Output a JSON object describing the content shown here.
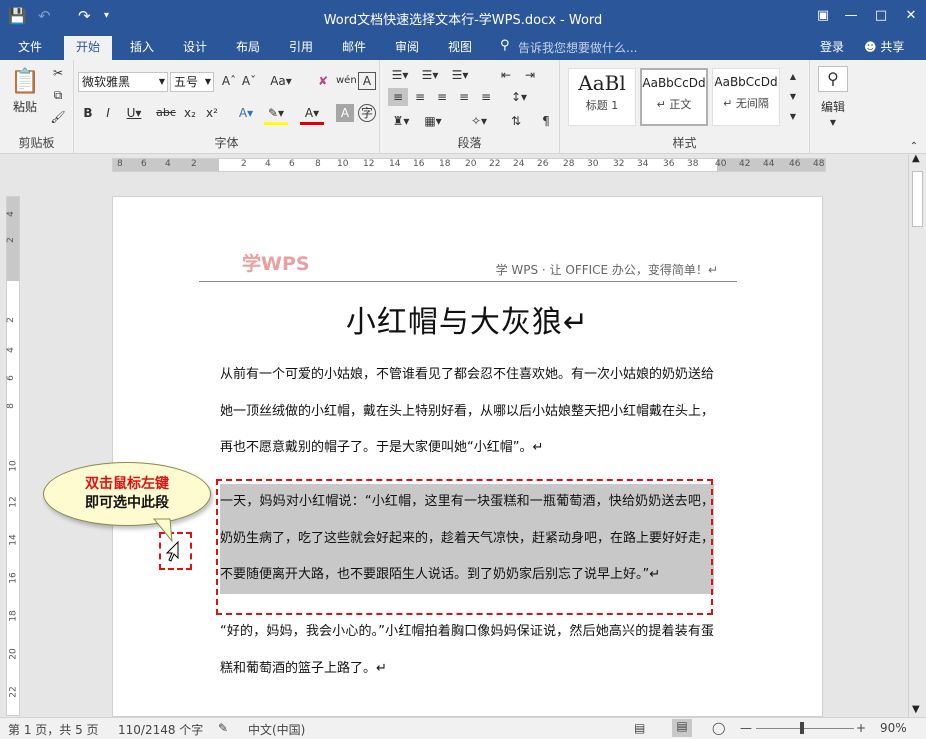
{
  "titlebar": {
    "title": "Word文档快速选择文本行-学WPS.docx - Word",
    "save_icon": "save-icon",
    "undo_icon": "undo-icon",
    "redo_icon": "redo-icon",
    "ribbon_display": "ribbon-display-icon",
    "minimize": "minimize-icon",
    "maximize": "maximize-icon",
    "close": "close-icon"
  },
  "tabs": [
    "文件",
    "开始",
    "插入",
    "设计",
    "布局",
    "引用",
    "邮件",
    "审阅",
    "视图"
  ],
  "active_tab": "开始",
  "tellme": "告诉我您想要做什么...",
  "login": "登录",
  "share": "共享",
  "ribbon": {
    "clipboard": {
      "paste": "粘贴",
      "label": "剪贴板"
    },
    "font": {
      "name": "微软雅黑",
      "size": "五号",
      "label": "字体"
    },
    "paragraph": {
      "label": "段落"
    },
    "styles": {
      "label": "样式",
      "items": [
        {
          "preview": "AaBl",
          "name": "标题 1"
        },
        {
          "preview": "AaBbCcDd",
          "name": "↵ 正文"
        },
        {
          "preview": "AaBbCcDd",
          "name": "↵ 无间隔"
        }
      ]
    },
    "editing": {
      "label": "编辑"
    }
  },
  "ruler_h": [
    "8",
    "6",
    "4",
    "2",
    "",
    "2",
    "4",
    "6",
    "8",
    "10",
    "12",
    "14",
    "16",
    "18",
    "20",
    "22",
    "24",
    "26",
    "28",
    "30",
    "32",
    "34",
    "36",
    "38",
    "40",
    "42",
    "44",
    "46",
    "48"
  ],
  "ruler_v": [
    "4",
    "2",
    "",
    "2",
    "4",
    "6",
    "8",
    "10",
    "12",
    "14",
    "16",
    "18",
    "20",
    "22"
  ],
  "document": {
    "header_logo": "学WPS",
    "header_text": "学 WPS · 让 OFFICE 办公，变得简单！↵",
    "title": "小红帽与大灰狼↵",
    "paragraphs": [
      "从前有一个可爱的小姑娘，不管谁看见了都会忍不住喜欢她。有一次小姑娘的奶奶送给她一顶丝绒做的小红帽，戴在头上特别好看，从哪以后小姑娘整天把小红帽戴在头上，再也不愿意戴别的帽子了。于是大家便叫她“小红帽”。↵",
      "一天，妈妈对小红帽说：“小红帽，这里有一块蛋糕和一瓶葡萄酒，快给奶奶送去吧，奶奶生病了，吃了这些就会好起来的，趁着天气凉快，赶紧动身吧，在路上要好好走，不要随便离开大路，也不要跟陌生人说话。到了奶奶家后别忘了说早上好。”↵",
      "“好的，妈妈，我会小心的。”小红帽拍着胸口像妈妈保证说，然后她高兴的提着装有蛋糕和葡萄酒的篮子上路了。↵"
    ]
  },
  "callout": {
    "line1": "双击鼠标左键",
    "line2": "即可选中此段"
  },
  "statusbar": {
    "page": "第 1 页，共 5 页",
    "words": "110/2148 个字",
    "language": "中文(中国)",
    "zoom": "90%"
  }
}
